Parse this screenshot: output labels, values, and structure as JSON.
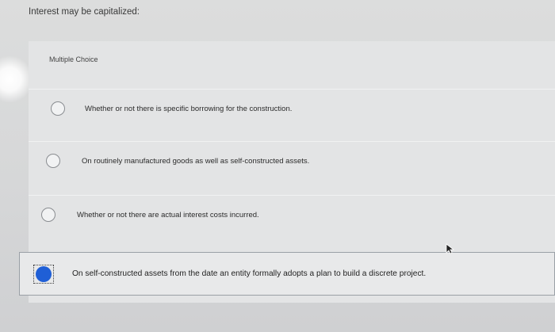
{
  "question": {
    "text": "Interest may be capitalized:"
  },
  "question_type": "Multiple Choice",
  "options": [
    {
      "label": "Whether or not there is specific borrowing for the construction.",
      "selected": false
    },
    {
      "label": "On routinely manufactured goods as well as self-constructed assets.",
      "selected": false
    },
    {
      "label": "Whether or not there are actual interest costs incurred.",
      "selected": false
    },
    {
      "label": "On self-constructed assets from the date an entity formally adopts a plan to build a discrete project.",
      "selected": true
    }
  ],
  "colors": {
    "selected_radio": "#1f5fd6",
    "background": "#d9dadb"
  }
}
